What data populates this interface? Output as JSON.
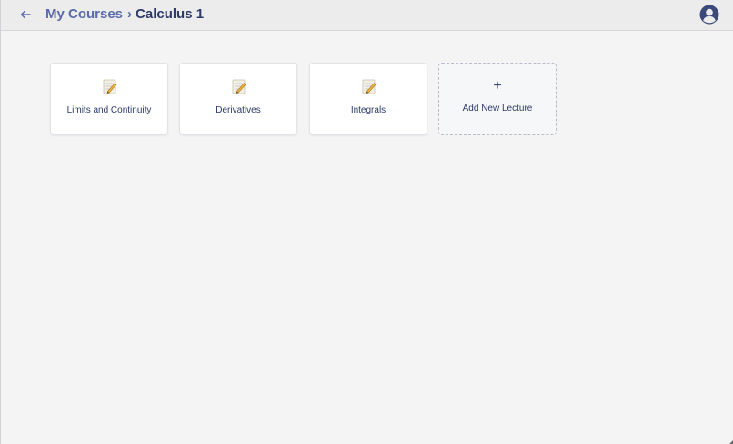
{
  "header": {
    "back_icon": "arrow-left-icon",
    "breadcrumb": {
      "parent": "My Courses",
      "separator": "›",
      "current": "Calculus 1"
    },
    "avatar_icon": "user-avatar-icon"
  },
  "lectures": [
    {
      "title": "Limits and Continuity",
      "icon": "memo-pencil-icon"
    },
    {
      "title": "Derivatives",
      "icon": "memo-pencil-icon"
    },
    {
      "title": "Integrals",
      "icon": "memo-pencil-icon"
    }
  ],
  "add_lecture": {
    "plus": "+",
    "label": "Add New Lecture"
  },
  "colors": {
    "accent": "#5b6aa8",
    "title_text": "#2c3a67",
    "background": "#f4f4f5",
    "header_bg": "#ececec"
  }
}
